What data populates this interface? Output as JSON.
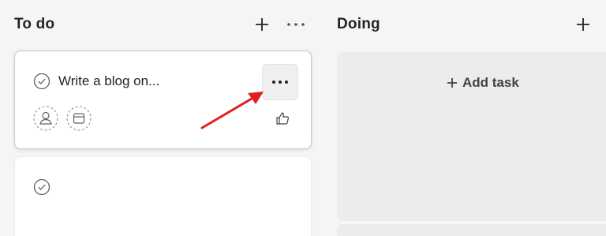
{
  "columns": [
    {
      "title": "To do"
    },
    {
      "title": "Doing"
    }
  ],
  "todo": {
    "cards": [
      {
        "title": "Write a blog on..."
      },
      {
        "title": ""
      }
    ]
  },
  "doing": {
    "add_task_label": "Add task"
  },
  "icons": {
    "add": "plus-icon",
    "more": "ellipsis-icon",
    "complete": "check-circle-icon",
    "assign": "person-icon",
    "due_date": "calendar-icon",
    "like": "thumbs-up-icon",
    "annotation": "red-arrow"
  },
  "colors": {
    "background": "#f5f5f5",
    "card": "#ffffff",
    "doing_area": "#ececec",
    "annotation_arrow": "#e02020"
  }
}
